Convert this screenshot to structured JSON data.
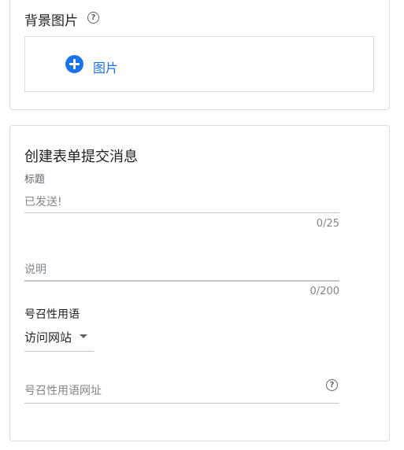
{
  "background_section": {
    "title": "背景图片",
    "add_image_label": "图片"
  },
  "form_message": {
    "title": "创建表单提交消息",
    "headline_label": "标题",
    "headline_value": "已发送!",
    "headline_counter": "0/25",
    "description_placeholder": "说明",
    "description_counter": "0/200",
    "cta_label": "号召性用语",
    "cta_selected": "访问网站",
    "cta_url_placeholder": "号召性用语网址"
  },
  "colors": {
    "accent": "#1a73e8",
    "border": "#dadce0",
    "muted_text": "#80868b"
  }
}
